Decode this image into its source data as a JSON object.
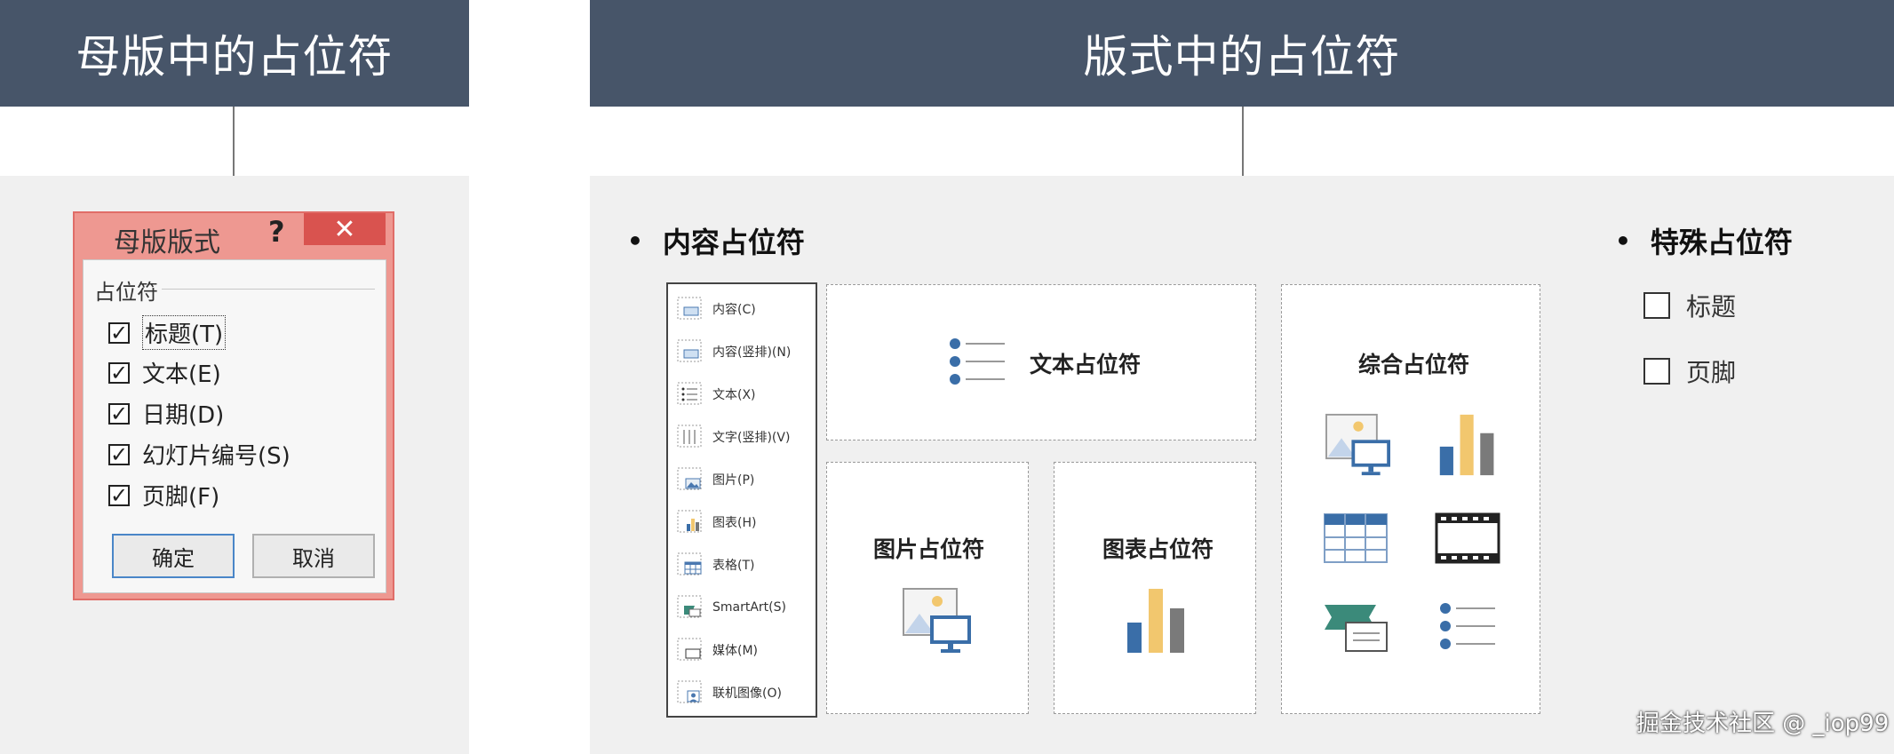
{
  "left": {
    "header": "母版中的占位符",
    "dialog": {
      "title": "母版版式",
      "help": "?",
      "close": "✕",
      "group_label": "占位符",
      "options": [
        {
          "label": "标题(T)",
          "checked": true
        },
        {
          "label": "文本(E)",
          "checked": true
        },
        {
          "label": "日期(D)",
          "checked": true
        },
        {
          "label": "幻灯片编号(S)",
          "checked": true
        },
        {
          "label": "页脚(F)",
          "checked": true
        }
      ],
      "ok": "确定",
      "cancel": "取消"
    }
  },
  "right": {
    "header": "版式中的占位符",
    "content_section": {
      "bullet": "•",
      "title": "内容占位符",
      "list_items": [
        {
          "label": "内容(C)",
          "icon": "content-icon"
        },
        {
          "label": "内容(竖排)(N)",
          "icon": "content-vertical-icon"
        },
        {
          "label": "文本(X)",
          "icon": "text-icon"
        },
        {
          "label": "文字(竖排)(V)",
          "icon": "text-vertical-icon"
        },
        {
          "label": "图片(P)",
          "icon": "picture-icon"
        },
        {
          "label": "图表(H)",
          "icon": "chart-icon"
        },
        {
          "label": "表格(T)",
          "icon": "table-icon"
        },
        {
          "label": "SmartArt(S)",
          "icon": "smartart-icon"
        },
        {
          "label": "媒体(M)",
          "icon": "media-icon"
        },
        {
          "label": "联机图像(O)",
          "icon": "online-image-icon"
        }
      ],
      "text_placeholder": "文本占位符",
      "picture_placeholder": "图片占位符",
      "chart_placeholder": "图表占位符",
      "combined_placeholder": "综合占位符"
    },
    "special_section": {
      "bullet": "•",
      "title": "特殊占位符",
      "items": [
        "标题",
        "页脚"
      ]
    }
  },
  "watermark": "掘金技术社区 @ _iop99",
  "colors": {
    "header_bg": "#475569",
    "accent_blue": "#3a6ea8",
    "accent_yellow": "#f2c76e",
    "accent_gray": "#7a7a7a",
    "accent_green": "#3b8a7a",
    "dialog_bg": "#ee9891"
  }
}
